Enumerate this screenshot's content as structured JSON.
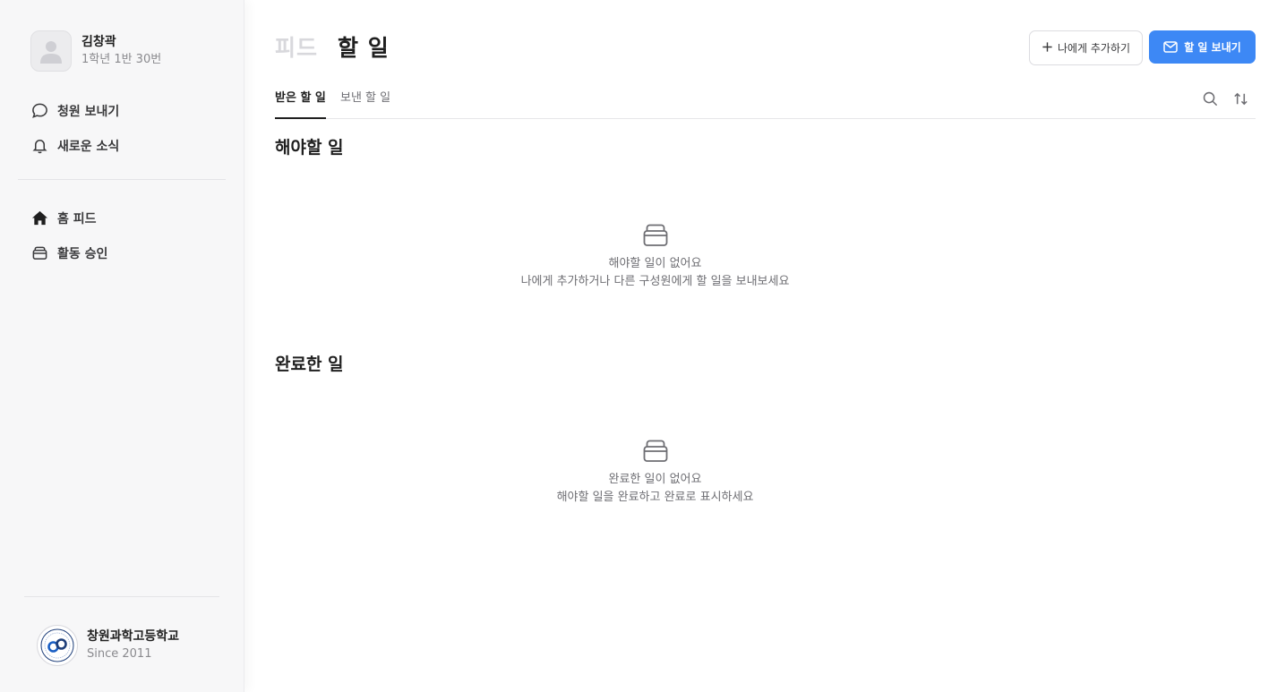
{
  "user": {
    "name": "김창곽",
    "class": "1학년 1반 30번"
  },
  "sidebar": {
    "top_items": [
      {
        "icon": "chat-bubble-icon",
        "label": "청원 보내기"
      },
      {
        "icon": "bell-icon",
        "label": "새로운 소식"
      }
    ],
    "bottom_items": [
      {
        "icon": "home-icon",
        "label": "홈 피드"
      },
      {
        "icon": "inbox-icon",
        "label": "활동 승인"
      }
    ]
  },
  "school": {
    "name": "창원과학고등학교",
    "since": "Since 2011"
  },
  "header": {
    "title_feed": "피드",
    "title_todo": "할 일",
    "add_button": "나에게 추가하기",
    "send_button": "할 일 보내기"
  },
  "tabs": {
    "received": "받은 할 일",
    "sent": "보낸 할 일"
  },
  "todo_section": {
    "title": "해야할 일",
    "empty_title": "해야할 일이 없어요",
    "empty_desc": "나에게 추가하거나 다른 구성원에게 할 일을 보내보세요"
  },
  "done_section": {
    "title": "완료한 일",
    "empty_title": "완료한 일이 없어요",
    "empty_desc": "해야할 일을 완료하고 완료로 표시하세요"
  },
  "colors": {
    "accent": "#3d88f5",
    "muted": "#d8d8dc"
  }
}
